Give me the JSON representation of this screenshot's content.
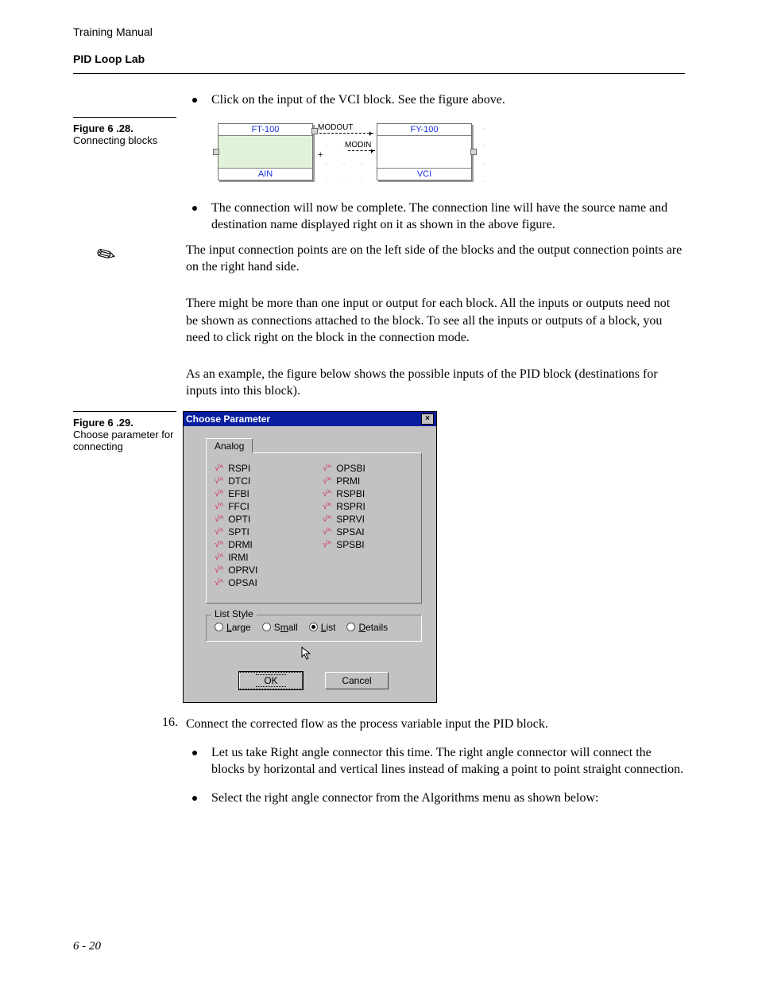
{
  "header": {
    "manual": "Training Manual",
    "section": "PID Loop Lab"
  },
  "figure628": {
    "label_bold": "Figure 6 .28.",
    "label_caption": "Connecting blocks",
    "left_block": {
      "title": "FT-100",
      "footer": "AIN"
    },
    "right_block": {
      "title": "FY-100",
      "footer": "VCI"
    },
    "out_label": "MODOUT",
    "in_label": "MODIN",
    "plus": "+"
  },
  "bullets_top": {
    "b1": "Click on the input of the VCI block. See the figure above.",
    "b2": "The connection will now be complete. The connection line will have the source name and destination name displayed right on it as shown in the above figure."
  },
  "note_para1": "The input connection points are on the left side of the blocks and the output connection points are on the right hand side.",
  "note_para2": "There might be more than one input or output for each block. All the inputs or outputs need not be shown as connections attached to the block. To see all the inputs or outputs of a block, you need to click right on the block in the connection mode.",
  "note_para3": "As an example, the figure below shows the possible inputs of the PID block (destinations for inputs into this block).",
  "figure629": {
    "label_bold": "Figure 6 .29.",
    "label_caption": "Choose parameter for connecting",
    "dialog_title": "Choose Parameter",
    "tab": "Analog",
    "col1": [
      "RSPI",
      "DTCI",
      "EFBI",
      "FFCI",
      "OPTI",
      "SPTI",
      "DRMI",
      "IRMI",
      "OPRVI",
      "OPSAI"
    ],
    "col2": [
      "OPSBI",
      "PRMI",
      "RSPBI",
      "RSPRI",
      "SPRVI",
      "SPSAI",
      "SPSBI"
    ],
    "group_title": "List Style",
    "radios": {
      "large": "Large",
      "small": "Small",
      "list": "List",
      "details": "Details",
      "selected": "list"
    },
    "ok": "OK",
    "cancel": "Cancel"
  },
  "step16": {
    "num": "16.",
    "text": "Connect the corrected flow as the process variable input the PID block.",
    "sub1": "Let us take Right angle connector this time. The right angle connector will connect the blocks by horizontal and vertical lines instead of making a point to point straight connection.",
    "sub2": "Select the right angle connector from the Algorithms menu as shown below:"
  },
  "footer": "6 - 20"
}
